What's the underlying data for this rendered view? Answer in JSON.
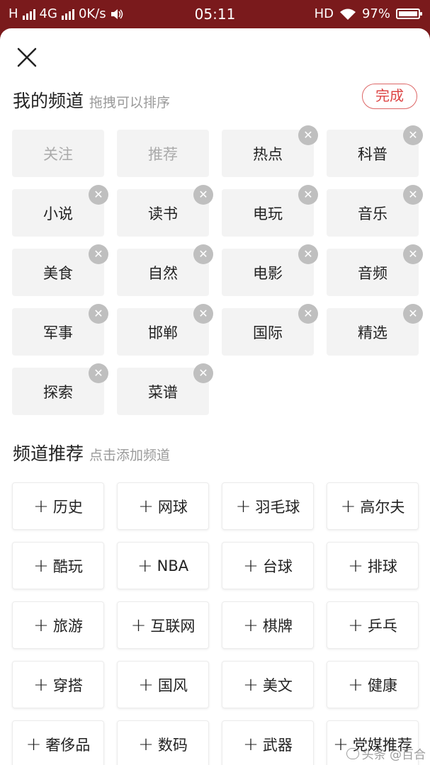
{
  "status_bar": {
    "network_label": "H",
    "network_type": "4G",
    "speed": "0K/s",
    "time": "05:11",
    "hd_label": "HD",
    "battery": "97%"
  },
  "header": {
    "my_channels_title": "我的频道",
    "my_channels_hint": "拖拽可以排序",
    "done_label": "完成"
  },
  "my_channels": [
    {
      "label": "关注",
      "removable": false
    },
    {
      "label": "推荐",
      "removable": false
    },
    {
      "label": "热点",
      "removable": true
    },
    {
      "label": "科普",
      "removable": true
    },
    {
      "label": "小说",
      "removable": true
    },
    {
      "label": "读书",
      "removable": true
    },
    {
      "label": "电玩",
      "removable": true
    },
    {
      "label": "音乐",
      "removable": true
    },
    {
      "label": "美食",
      "removable": true
    },
    {
      "label": "自然",
      "removable": true
    },
    {
      "label": "电影",
      "removable": true
    },
    {
      "label": "音频",
      "removable": true
    },
    {
      "label": "军事",
      "removable": true
    },
    {
      "label": "邯郸",
      "removable": true
    },
    {
      "label": "国际",
      "removable": true
    },
    {
      "label": "精选",
      "removable": true
    },
    {
      "label": "探索",
      "removable": true
    },
    {
      "label": "菜谱",
      "removable": true
    }
  ],
  "recommend": {
    "title": "频道推荐",
    "hint": "点击添加频道",
    "channels": [
      "历史",
      "网球",
      "羽毛球",
      "高尔夫",
      "酷玩",
      "NBA",
      "台球",
      "排球",
      "旅游",
      "互联网",
      "棋牌",
      "乒乓",
      "穿搭",
      "国风",
      "美文",
      "健康",
      "奢侈品",
      "数码",
      "武器",
      "党媒推荐"
    ]
  },
  "watermark": "头条 @百合"
}
